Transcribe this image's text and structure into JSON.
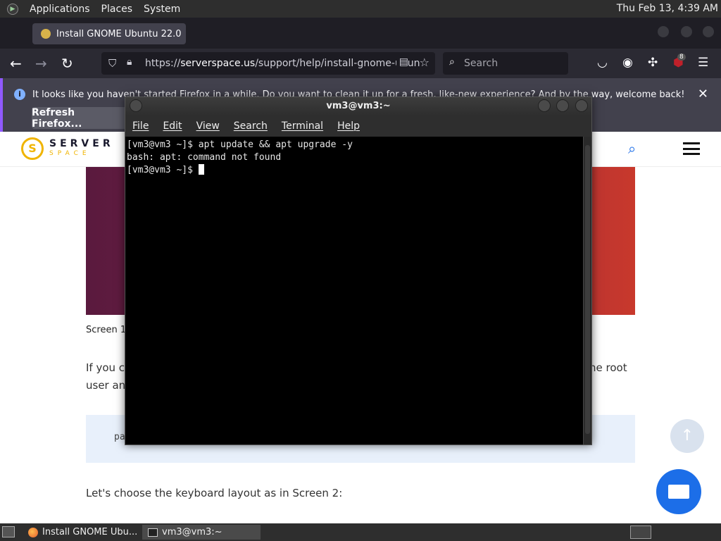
{
  "top_panel": {
    "menus": [
      "Applications",
      "Places",
      "System"
    ],
    "clock": "Thu Feb 13,  4:39 AM"
  },
  "browser": {
    "tab_title": "Install GNOME Ubuntu 22.0",
    "url_prefix": "https://",
    "url_domain": "serverspace.us",
    "url_path": "/support/help/install-gnome-ubun",
    "search_placeholder": "Search",
    "extension_badge": "8",
    "notice": {
      "text": "It looks like you haven't started Firefox in a while. Do you want to clean it up for a fresh, like-new experience? And by the way, welcome back!",
      "button": "Refresh Firefox..."
    }
  },
  "page": {
    "logo_word": "SERVER",
    "logo_sub": "SPACE",
    "caption": "Screen 1",
    "para1_start": "If you co",
    "para1_end": "he root",
    "para2_start": "user an",
    "code_snippet": "pa",
    "para3": "Let's choose the keyboard layout as in Screen 2:"
  },
  "terminal": {
    "title": "vm3@vm3:~",
    "menu": [
      "File",
      "Edit",
      "View",
      "Search",
      "Terminal",
      "Help"
    ],
    "lines": [
      "[vm3@vm3 ~]$ apt update && apt upgrade -y",
      "bash: apt: command not found",
      "[vm3@vm3 ~]$ "
    ]
  },
  "taskbar": {
    "firefox_task": "Install GNOME Ubu...",
    "terminal_task": "vm3@vm3:~"
  },
  "colors": {
    "accent": "#1c6ee8",
    "brand": "#f0b400",
    "notice_accent": "#9059ff"
  }
}
